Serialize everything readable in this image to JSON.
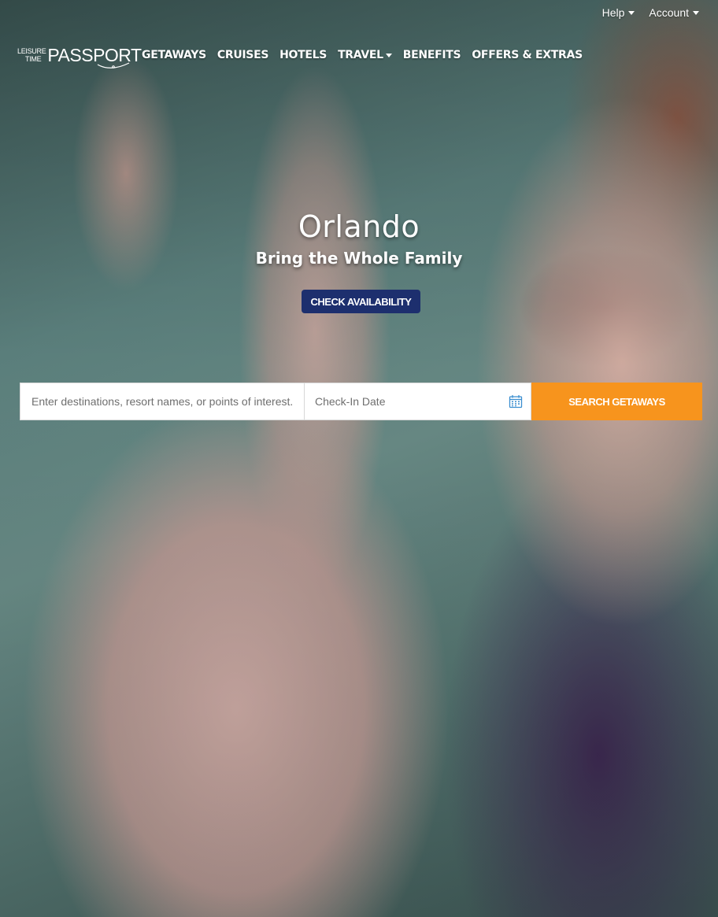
{
  "utility_nav": {
    "help": "Help",
    "account": "Account"
  },
  "logo": {
    "line1": "LEISURE",
    "line2": "TIME",
    "word": "PASSPORT"
  },
  "main_nav": {
    "items": [
      {
        "label": "GETAWAYS"
      },
      {
        "label": "CRUISES"
      },
      {
        "label": "HOTELS"
      },
      {
        "label": "TRAVEL"
      },
      {
        "label": "BENEFITS"
      },
      {
        "label": "OFFERS & EXTRAS"
      }
    ]
  },
  "hero": {
    "title": "Orlando",
    "subtitle": "Bring the Whole Family",
    "cta": "CHECK AVAILABILITY"
  },
  "search": {
    "destination_placeholder": "Enter destinations, resort names, or points of interest.",
    "checkin_placeholder": "Check-In Date",
    "button": "SEARCH GETAWAYS"
  },
  "colors": {
    "cta_bg": "#1d2f6e",
    "search_button_bg": "#f7941d",
    "calendar_icon": "#3b8fd0"
  },
  "icons": {
    "help_caret": "chevron-down-icon",
    "account_caret": "chevron-down-icon",
    "travel_caret": "chevron-down-icon",
    "calendar": "calendar-icon"
  }
}
